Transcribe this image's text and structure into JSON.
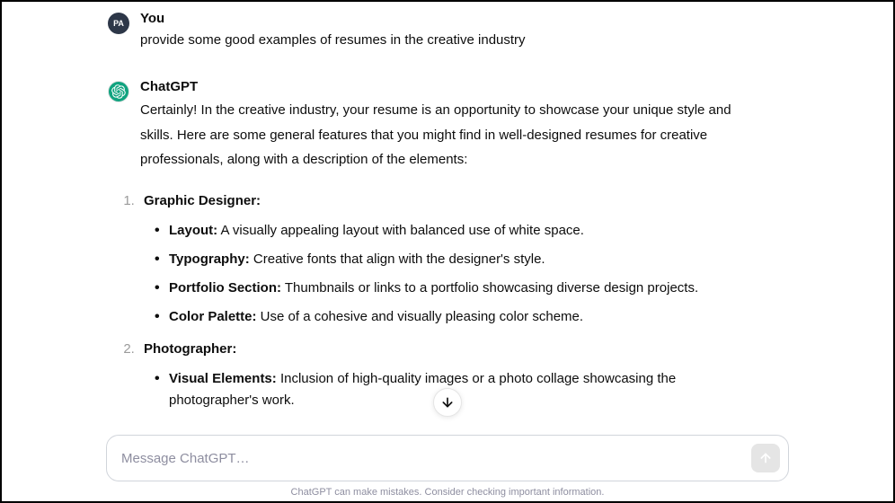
{
  "user": {
    "avatar_initials": "PA",
    "name": "You",
    "message": "provide some good examples of resumes in the creative industry"
  },
  "assistant": {
    "name": "ChatGPT",
    "intro": "Certainly! In the creative industry, your resume is an opportunity to showcase your unique style and skills. Here are some general features that you might find in well-designed resumes for creative professionals, along with a description of the elements:",
    "list": [
      {
        "title": "Graphic Designer:",
        "bullets": [
          {
            "label": "Layout:",
            "text": " A visually appealing layout with balanced use of white space."
          },
          {
            "label": "Typography:",
            "text": " Creative fonts that align with the designer's style."
          },
          {
            "label": "Portfolio Section:",
            "text": " Thumbnails or links to a portfolio showcasing diverse design projects."
          },
          {
            "label": "Color Palette:",
            "text": " Use of a cohesive and visually pleasing color scheme."
          }
        ]
      },
      {
        "title": "Photographer:",
        "bullets": [
          {
            "label": "Visual Elements:",
            "text": " Inclusion of high-quality images or a photo collage showcasing the photographer's work."
          }
        ]
      }
    ]
  },
  "input": {
    "placeholder": "Message ChatGPT…"
  },
  "disclaimer": "ChatGPT can make mistakes. Consider checking important information."
}
